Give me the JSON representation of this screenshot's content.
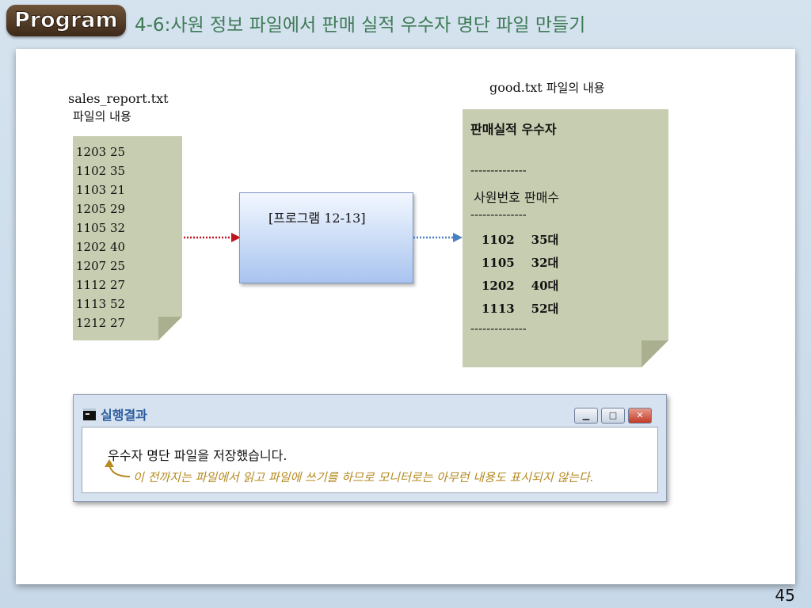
{
  "header": {
    "badge": "Program",
    "title": "4-6:사원 정보 파일에서 판매 실적 우수자 명단 파일 만들기"
  },
  "left_file": {
    "label_line1": "sales_report.txt",
    "label_line2": "파일의 내용",
    "lines": [
      "1203 25",
      "1102 35",
      "1103 21",
      "1205 29",
      "1105 32",
      "1202 40",
      "1207 25",
      "1112 27",
      "1113 52",
      "1212 27"
    ]
  },
  "program": {
    "label": "[프로그램 12-13]"
  },
  "right_file": {
    "label_name": "good.txt",
    "label_suffix": "파일의 내용",
    "heading": "판매실적 우수자",
    "dash1": "--------------",
    "col_header": "사원번호  판매수",
    "dash2": "--------------",
    "rows": [
      "1102    35대",
      "1105    32대",
      "1202    40대",
      "1113    52대"
    ],
    "dash3": "--------------"
  },
  "result_window": {
    "title": "실행결과",
    "output": "우수자 명단 파일을 저장했습니다.",
    "annotation": "이 전까지는 파일에서 읽고 파일에 쓰기를 하므로 모니터로는 아무런 내용도 표시되지 않는다.",
    "btn_min": "▁",
    "btn_max": "□",
    "btn_close": "✕"
  },
  "page_number": "45",
  "colors": {
    "arrow_left": "#c0141c",
    "arrow_right": "#4a7fc1",
    "title": "#3e7a55",
    "annotation": "#b58a22"
  }
}
